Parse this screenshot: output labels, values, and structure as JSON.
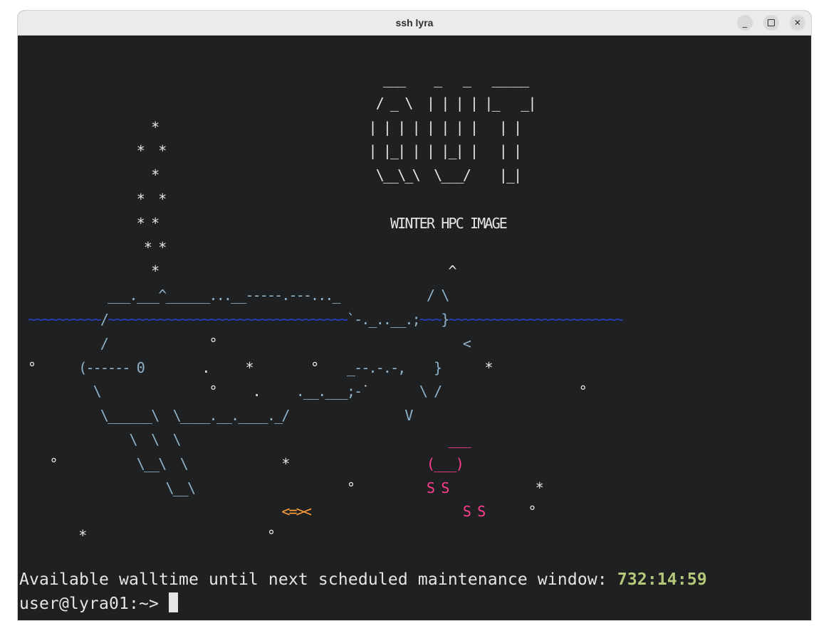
{
  "window": {
    "title": "ssh lyra",
    "buttons": {
      "minimize_icon": "minimize-icon",
      "maximize_icon": "maximize-icon",
      "close_icon": "close-icon"
    }
  },
  "terminal": {
    "colors": {
      "background": "#1f2022",
      "foreground": "#e5e5e5",
      "ship": "#8fb3cb",
      "waves": "#2743c4",
      "fish": "#ff9e3b",
      "diver": "#ff3d8f",
      "walltime": "#b6c77a"
    },
    "banner_caption": "WINTER HPC IMAGE",
    "fish_art": "<=><",
    "status_label": "Available walltime until next scheduled maintenance window: ",
    "walltime": "732:14:59",
    "prompt": "user@lyra01:~> "
  }
}
